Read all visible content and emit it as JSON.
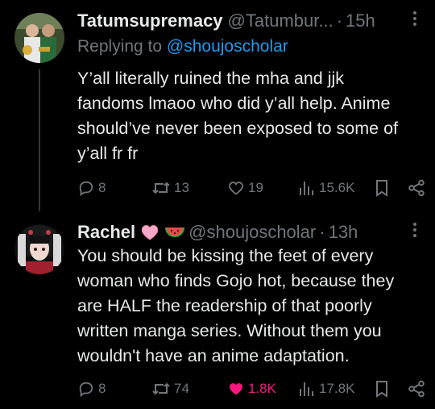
{
  "tweets": [
    {
      "author_name": "Tatumsupremacy",
      "handle": "@Tatumbur...",
      "separator": "·",
      "time": "15h",
      "replying_label": "Replying to",
      "replying_to": "@shoujoscholar",
      "body_lines": [
        "Y’all literally ruined the mha and jjk",
        "fandoms lmaoo who did y’all help. Anime",
        "should’ve never been exposed to some of",
        "y’all fr fr"
      ],
      "stats": {
        "replies": "8",
        "reposts": "13",
        "likes": "19",
        "views": "15.6K",
        "liked": false
      }
    },
    {
      "author_name": "Rachel",
      "name_emojis": [
        "pink-heart",
        "watermelon"
      ],
      "handle": "@shoujoscholar",
      "separator": "·",
      "time": "13h",
      "body_lines": [
        "You should be kissing the feet of every",
        "woman who finds Gojo hot, because they",
        "are HALF the readership of that poorly",
        "written manga series. Without them you",
        "wouldn't have an anime adaptation."
      ],
      "stats": {
        "replies": "8",
        "reposts": "74",
        "likes": "1.8K",
        "views": "17.8K",
        "liked": true
      }
    }
  ],
  "icons": [
    "reply-icon",
    "repost-icon",
    "like-icon",
    "views-icon",
    "bookmark-icon",
    "share-icon",
    "more-icon"
  ],
  "colors": {
    "background": "#000000",
    "text": "#e7e9ea",
    "muted": "#71767b",
    "link": "#1d9bf0",
    "like": "#f91880"
  }
}
